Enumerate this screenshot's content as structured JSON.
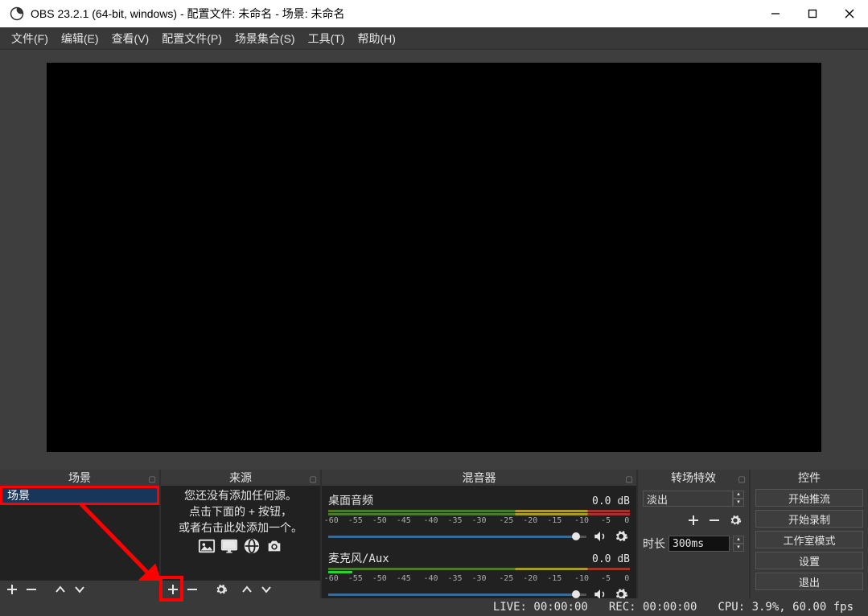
{
  "titlebar": {
    "title": "OBS 23.2.1 (64-bit, windows) - 配置文件: 未命名 - 场景: 未命名"
  },
  "menu": {
    "file": "文件(F)",
    "edit": "编辑(E)",
    "view": "查看(V)",
    "profile": "配置文件(P)",
    "scene_collection": "场景集合(S)",
    "tools": "工具(T)",
    "help": "帮助(H)"
  },
  "docks": {
    "scenes": {
      "title": "场景",
      "items": [
        "场景"
      ]
    },
    "sources": {
      "title": "来源",
      "empty_msg_line1": "您还没有添加任何源。",
      "empty_msg_line2": "点击下面的 + 按钮，",
      "empty_msg_line3": "或者右击此处添加一个。"
    },
    "mixer": {
      "title": "混音器",
      "channels": [
        {
          "name": "桌面音频",
          "db": "0.0 dB",
          "live_width_pct": 0
        },
        {
          "name": "麦克风/Aux",
          "db": "0.0 dB",
          "live_width_pct": 8
        }
      ],
      "scale": [
        "-60",
        "-55",
        "-50",
        "-45",
        "-40",
        "-35",
        "-30",
        "-25",
        "-20",
        "-15",
        "-10",
        "-5",
        "0"
      ]
    },
    "transitions": {
      "title": "转场特效",
      "selected": "淡出",
      "duration_label": "时长",
      "duration_value": "300ms"
    },
    "controls": {
      "title": "控件",
      "buttons": {
        "stream": "开始推流",
        "record": "开始录制",
        "studio": "工作室模式",
        "settings": "设置",
        "exit": "退出"
      }
    }
  },
  "status": {
    "live": "LIVE: 00:00:00",
    "rec": "REC: 00:00:00",
    "cpu": "CPU: 3.9%, 60.00 fps"
  }
}
